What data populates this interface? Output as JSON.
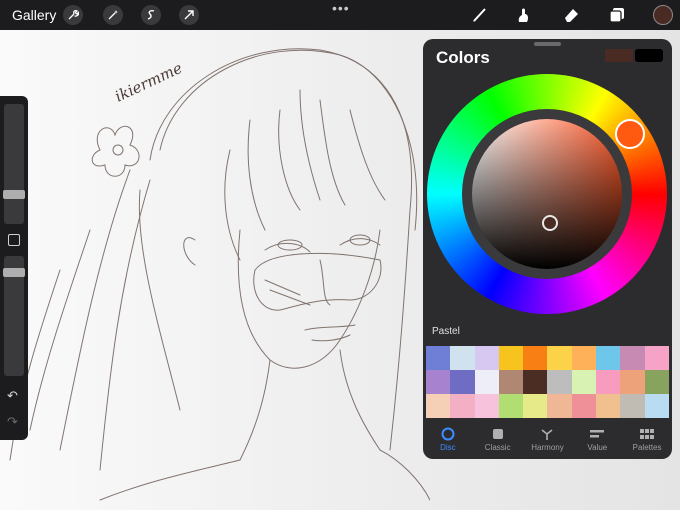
{
  "topbar": {
    "gallery_label": "Gallery",
    "dots": "•••",
    "left_tools": [
      "wrench-icon",
      "magic-wand-icon",
      "selection-icon",
      "transform-icon"
    ],
    "right_tools": [
      "brush-icon",
      "smudge-icon",
      "eraser-icon",
      "layers-icon"
    ],
    "current_color": "#4a2b23"
  },
  "canvas": {
    "signature": "ikiermme"
  },
  "colors_panel": {
    "title": "Colors",
    "previous_color": "#4a2b23",
    "current_color": "#000000",
    "palette_name": "Pastel",
    "swatches": [
      "#6f7fd6",
      "#cfe2ee",
      "#d6c8f0",
      "#f7c41f",
      "#f77f13",
      "#fcd248",
      "#ffb15a",
      "#6ec6ea",
      "#c78bb3",
      "#f6a3c7",
      "#a682cf",
      "#6f6cc4",
      "#eeeef8",
      "#b08772",
      "#4b2d24",
      "#bdbdbd",
      "#d7f2b2",
      "#f79cbf",
      "#eea27a",
      "#87a35e",
      "#f5cfb6",
      "#f3b0c5",
      "#f6c2dc",
      "#b0de73",
      "#e7ea88",
      "#efb796",
      "#ef8f97",
      "#f0c18f",
      "#c0bbb3",
      "#b9dcf3"
    ],
    "tabs": [
      {
        "label": "Disc",
        "icon": "disc-icon"
      },
      {
        "label": "Classic",
        "icon": "classic-icon"
      },
      {
        "label": "Harmony",
        "icon": "harmony-icon"
      },
      {
        "label": "Value",
        "icon": "value-icon"
      },
      {
        "label": "Palettes",
        "icon": "palettes-icon"
      }
    ],
    "active_tab": "Disc"
  }
}
